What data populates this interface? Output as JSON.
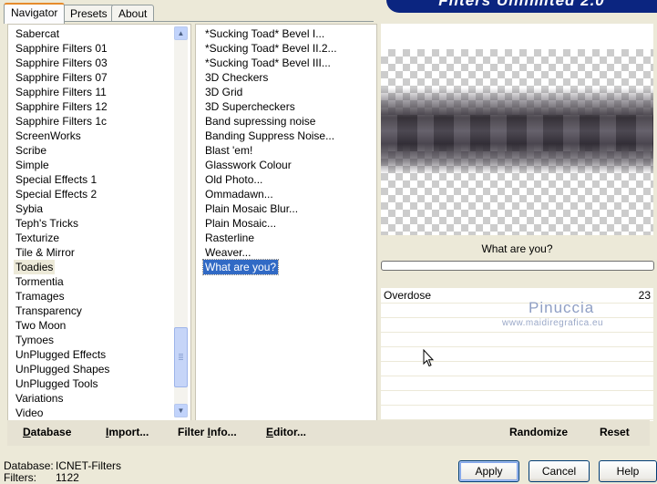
{
  "tabs": [
    "Navigator",
    "Presets",
    "About"
  ],
  "banner_text": "Filters Unlimited 2.0",
  "categories": [
    "Sabercat",
    "Sapphire Filters 01",
    "Sapphire Filters 03",
    "Sapphire Filters 07",
    "Sapphire Filters 11",
    "Sapphire Filters 12",
    "Sapphire Filters 1c",
    "ScreenWorks",
    "Scribe",
    "Simple",
    "Special Effects 1",
    "Special Effects 2",
    "Sybia",
    "Teph's Tricks",
    "Texturize",
    "Tile & Mirror",
    "Toadies",
    "Tormentia",
    "Tramages",
    "Transparency",
    "Two Moon",
    "Tymoes",
    "UnPlugged Effects",
    "UnPlugged Shapes",
    "UnPlugged Tools",
    "Variations",
    "Video"
  ],
  "selected_category": "Toadies",
  "filters": [
    "*Sucking Toad*  Bevel I...",
    "*Sucking Toad*  Bevel II.2...",
    "*Sucking Toad*  Bevel III...",
    "3D Checkers",
    "3D Grid",
    "3D Supercheckers",
    "Band supressing noise",
    "Banding Suppress Noise...",
    "Blast 'em!",
    "Glasswork Colour",
    "Old Photo...",
    "Ommadawn...",
    "Plain Mosaic Blur...",
    "Plain Mosaic...",
    "Rasterline",
    "Weaver...",
    "What are you?"
  ],
  "selected_filter": "What are you?",
  "preview_caption": "What are you?",
  "progress": 0,
  "params": [
    {
      "name": "Overdose",
      "value": "23"
    }
  ],
  "watermark": {
    "title": "Pinuccia",
    "url": "www.maidiregrafica.eu"
  },
  "toolbar": {
    "database": {
      "u": "D",
      "rest": "atabase"
    },
    "import": {
      "u": "I",
      "rest": "mport..."
    },
    "filter_info": {
      "pre": "Filter ",
      "u": "I",
      "rest": "nfo..."
    },
    "editor": {
      "u": "E",
      "rest": "ditor..."
    },
    "randomize": "Randomize",
    "reset": "Reset"
  },
  "status": {
    "database_label": "Database:",
    "database_value": "ICNET-Filters",
    "filters_label": "Filters:",
    "filters_value": "1122"
  },
  "buttons": {
    "apply": "Apply",
    "cancel": "Cancel",
    "help": "Help"
  },
  "icons": {
    "scroll_up": "chevron-up-icon",
    "scroll_down": "chevron-down-icon",
    "cursor": "mouse-pointer-icon"
  }
}
